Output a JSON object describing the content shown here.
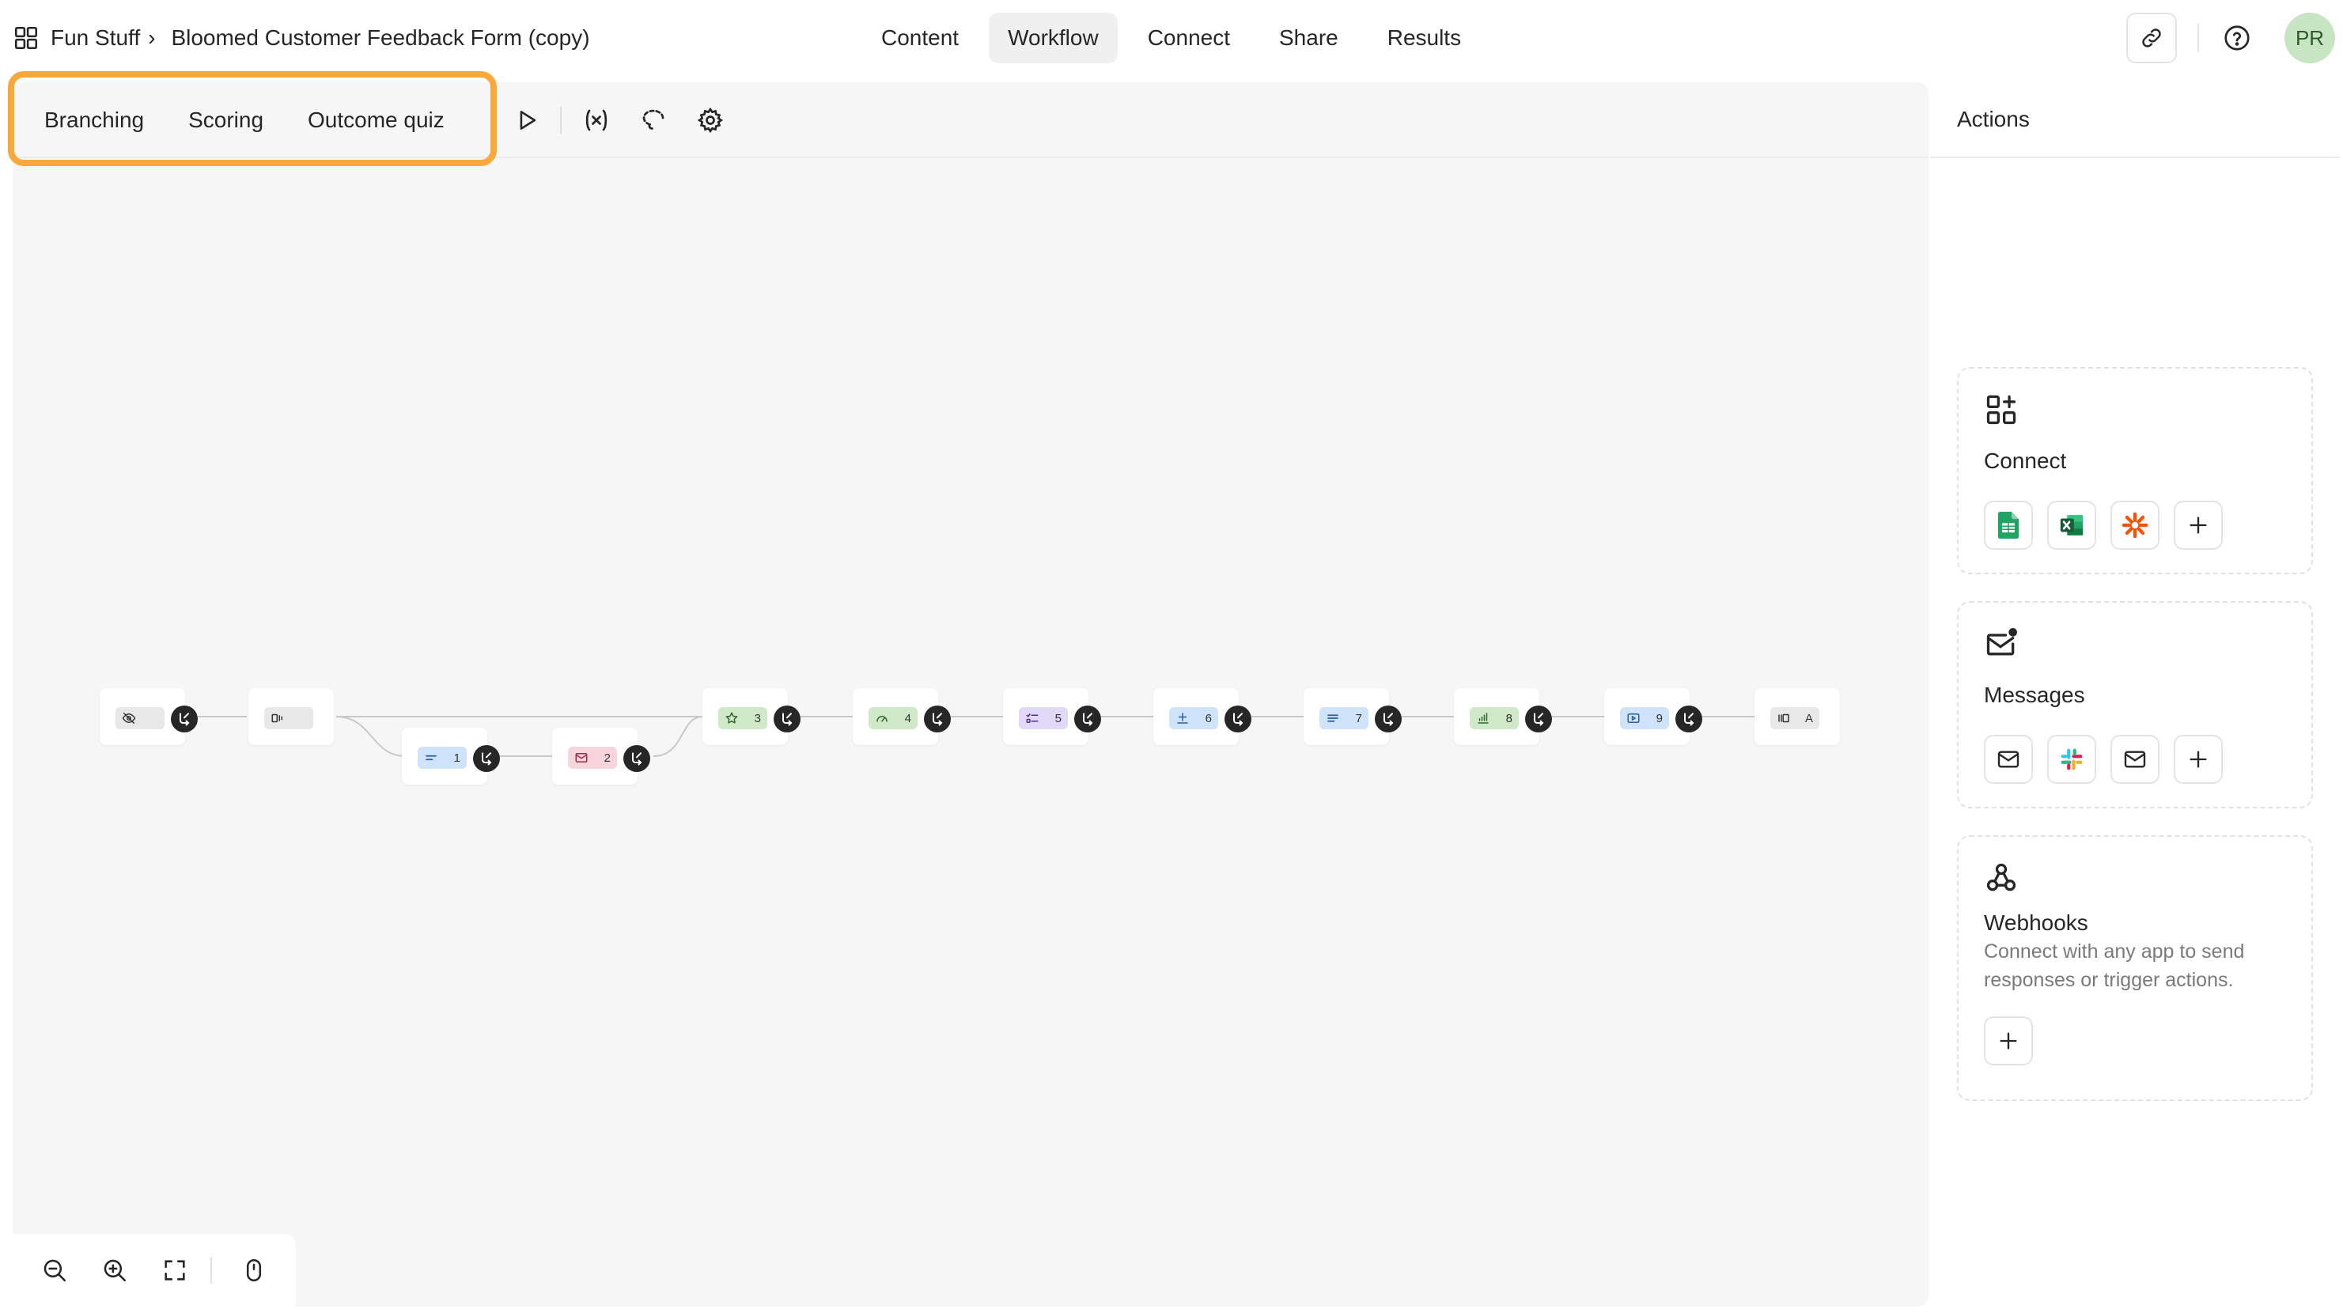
{
  "breadcrumb": {
    "workspace": "Fun Stuff",
    "separator": "›",
    "form_title": "Bloomed Customer Feedback Form (copy)"
  },
  "nav": {
    "tabs": [
      {
        "label": "Content",
        "active": false
      },
      {
        "label": "Workflow",
        "active": true
      },
      {
        "label": "Connect",
        "active": false
      },
      {
        "label": "Share",
        "active": false
      },
      {
        "label": "Results",
        "active": false
      }
    ]
  },
  "user": {
    "initials": "PR"
  },
  "toolbar": {
    "tabs": [
      "Branching",
      "Scoring",
      "Outcome quiz"
    ],
    "highlight_color": "#f8a93b"
  },
  "flow": {
    "nodes": [
      {
        "id": "welcome",
        "label": "",
        "icon": "eye-off-icon",
        "color": "#e8e8e8"
      },
      {
        "id": "statement",
        "label": "",
        "icon": "statement-icon",
        "color": "#e8e8e8"
      },
      {
        "id": "q1",
        "label": "1",
        "icon": "short-text-icon",
        "color": "#cfe3fb"
      },
      {
        "id": "q2",
        "label": "2",
        "icon": "email-icon",
        "color": "#f8d5dc"
      },
      {
        "id": "q3",
        "label": "3",
        "icon": "star-icon",
        "color": "#cfe9c9"
      },
      {
        "id": "q4",
        "label": "4",
        "icon": "gauge-icon",
        "color": "#cfe9c9"
      },
      {
        "id": "q5",
        "label": "5",
        "icon": "multiple-choice-icon",
        "color": "#e2d8f8"
      },
      {
        "id": "q6",
        "label": "6",
        "icon": "number-icon",
        "color": "#cfe3fb"
      },
      {
        "id": "q7",
        "label": "7",
        "icon": "long-text-icon",
        "color": "#cfe3fb"
      },
      {
        "id": "q8",
        "label": "8",
        "icon": "chart-icon",
        "color": "#cfe9c9"
      },
      {
        "id": "q9",
        "label": "9",
        "icon": "video-icon",
        "color": "#cfe3fb"
      },
      {
        "id": "end",
        "label": "A",
        "icon": "ending-icon",
        "color": "#e8e8e8"
      }
    ]
  },
  "panel": {
    "title": "Actions",
    "connect": {
      "title": "Connect",
      "apps": [
        "google-sheets-icon",
        "excel-icon",
        "zapier-icon"
      ]
    },
    "messages": {
      "title": "Messages",
      "apps": [
        "email-icon",
        "slack-icon",
        "email-icon"
      ]
    },
    "webhooks": {
      "title": "Webhooks",
      "description": "Connect with any app to send responses or trigger actions."
    }
  }
}
